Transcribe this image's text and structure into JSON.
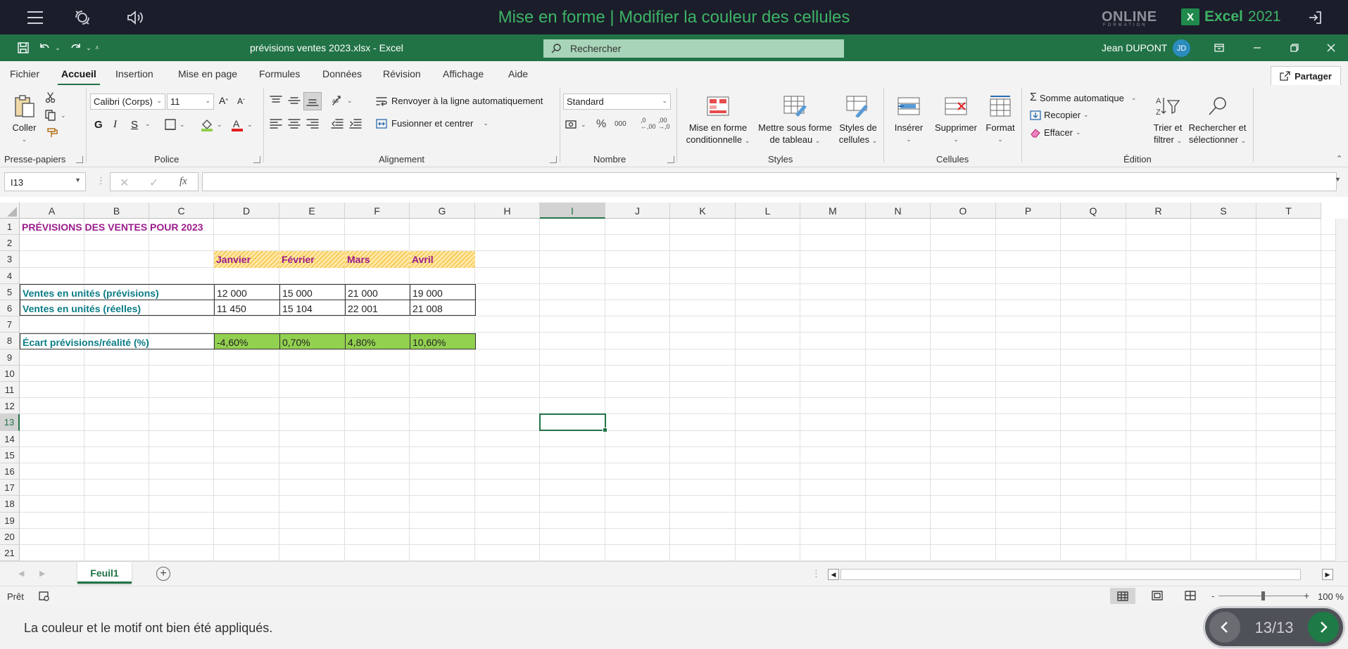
{
  "tutorial": {
    "title": "Mise en forme | Modifier la couleur des cellules",
    "brand_online": "ONLINE",
    "brand_online_sub": "FORMATION",
    "brand_excel": "Excel",
    "brand_version": "2021",
    "brand_x": "X"
  },
  "titlebar": {
    "file_title": "prévisions ventes 2023.xlsx - Excel",
    "search_placeholder": "Rechercher",
    "user_name": "Jean DUPONT",
    "user_initials": "JD"
  },
  "menu": {
    "tabs": [
      "Fichier",
      "Accueil",
      "Insertion",
      "Mise en page",
      "Formules",
      "Données",
      "Révision",
      "Affichage",
      "Aide"
    ],
    "share": "Partager"
  },
  "ribbon": {
    "clipboard": {
      "label": "Presse-papiers",
      "paste": "Coller"
    },
    "font": {
      "label": "Police",
      "font_name": "Calibri (Corps)",
      "font_size": "11",
      "bold": "G",
      "italic": "I",
      "underline": "S"
    },
    "alignment": {
      "label": "Alignement",
      "wrap": "Renvoyer à la ligne automatiquement",
      "merge": "Fusionner et centrer"
    },
    "number": {
      "label": "Nombre",
      "format": "Standard"
    },
    "styles": {
      "label": "Styles",
      "conditional_1": "Mise en forme",
      "conditional_2": "conditionnelle",
      "table_1": "Mettre sous forme",
      "table_2": "de tableau",
      "cell_1": "Styles de",
      "cell_2": "cellules"
    },
    "cells": {
      "label": "Cellules",
      "insert": "Insérer",
      "delete": "Supprimer",
      "format": "Format"
    },
    "editing": {
      "label": "Édition",
      "autosum": "Somme automatique",
      "fill": "Recopier",
      "clear": "Effacer",
      "sort_1": "Trier et",
      "sort_2": "filtrer",
      "find_1": "Rechercher et",
      "find_2": "sélectionner"
    }
  },
  "formula_bar": {
    "name_box": "I13",
    "fx": "fx",
    "value": ""
  },
  "sheet": {
    "columns": [
      "A",
      "B",
      "C",
      "D",
      "E",
      "F",
      "G",
      "H",
      "I",
      "J",
      "K",
      "L",
      "M",
      "N",
      "O",
      "P",
      "Q",
      "R",
      "S",
      "T"
    ],
    "rows": [
      "1",
      "2",
      "3",
      "4",
      "5",
      "6",
      "7",
      "8",
      "9",
      "10",
      "11",
      "12",
      "13",
      "14",
      "15",
      "16",
      "17",
      "18",
      "19",
      "20",
      "21"
    ],
    "selected_column": "I",
    "selected_row": "13",
    "cells": {
      "title": "PRÉVISIONS DES VENTES POUR 2023",
      "months": [
        "Janvier",
        "Février",
        "Mars",
        "Avril"
      ],
      "row5_label": "Ventes en unités (prévisions)",
      "row5_values": [
        "12 000",
        "15 000",
        "21 000",
        "19 000"
      ],
      "row6_label": "Ventes en unités (réelles)",
      "row6_values": [
        "11 450",
        "15 104",
        "22 001",
        "21 008"
      ],
      "row8_label": "Écart prévisions/réalité (%)",
      "row8_values": [
        "-4,60%",
        "0,70%",
        "4,80%",
        "10,60%"
      ]
    },
    "tab": "Feuil1"
  },
  "status": {
    "ready": "Prêt",
    "zoom": "100 %",
    "zoom_minus": "-",
    "zoom_plus": "+",
    "zoom_level": 0.5
  },
  "colors": {
    "accent": "#217346",
    "teal": "#0b7c86",
    "purple": "#9b1c8c",
    "green_fill": "#92d050",
    "hatch": "#f7c54e"
  },
  "bottom": {
    "instruction": "La couleur et le motif ont bien été appliqués.",
    "step": "13/13"
  }
}
